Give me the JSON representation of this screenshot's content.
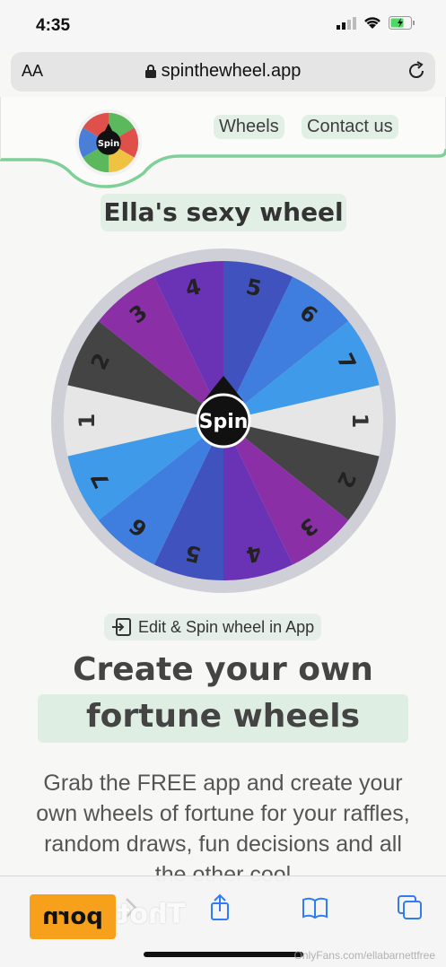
{
  "status": {
    "time": "4:35"
  },
  "browser": {
    "text_size_label": "AA",
    "url": "spinthewheel.app"
  },
  "site": {
    "nav": [
      "Wheels",
      "Contact us"
    ],
    "logo_label": "Spin"
  },
  "wheel": {
    "title": "Ella's sexy wheel",
    "center_label": "Spin",
    "segments": [
      {
        "label": "1",
        "color": "#e6e6e6"
      },
      {
        "label": "2",
        "color": "#444444"
      },
      {
        "label": "3",
        "color": "#8a2fa6"
      },
      {
        "label": "4",
        "color": "#6a33b5"
      },
      {
        "label": "5",
        "color": "#3f52bd"
      },
      {
        "label": "6",
        "color": "#3f7ede"
      },
      {
        "label": "7",
        "color": "#3f9aea"
      },
      {
        "label": "1",
        "color": "#e6e6e6"
      },
      {
        "label": "2",
        "color": "#444444"
      },
      {
        "label": "3",
        "color": "#8a2fa6"
      },
      {
        "label": "4",
        "color": "#6a33b5"
      },
      {
        "label": "5",
        "color": "#3f52bd"
      },
      {
        "label": "6",
        "color": "#3f7ede"
      },
      {
        "label": "7",
        "color": "#3f9aea"
      }
    ]
  },
  "cta": {
    "edit_label": "Edit & Spin wheel in App",
    "headline_line1": "Create your own",
    "headline_line2": "fortune wheels",
    "paragraph": "Grab the FREE app and create your own wheels of fortune for your raffles, random draws, fun decisions and all the other cool"
  },
  "overlay": {
    "badge": "porn",
    "badge_ghost": "Thot",
    "watermark": "OnlyFans.com/ellabarnettfree"
  },
  "colors": {
    "accent_green": "#7fcf98",
    "highlight": "#e2efe5"
  }
}
